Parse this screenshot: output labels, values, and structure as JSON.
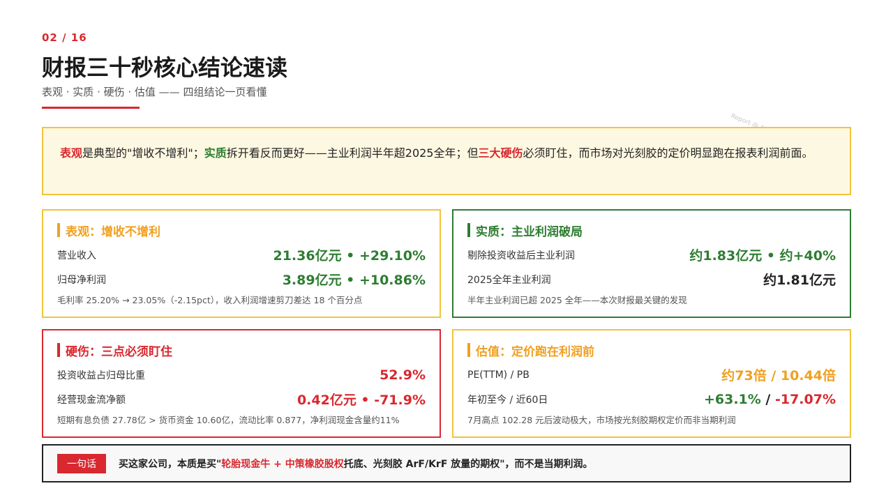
{
  "page_number": "02 / 16",
  "title": "财报三十秒核心结论速读",
  "subtitle": "表观 · 实质 · 硬伤 · 估值 —— 四组结论一页看懂",
  "watermark": "Report @ Alibaba",
  "summary": {
    "k1": "表观",
    "t1": "是典型的\"增收不增利\"；",
    "k2": "实质",
    "t2": "拆开看反而更好——主业利润半年超2025全年；但",
    "k3": "三大硬伤",
    "t3": "必须盯住，而市场对光刻胶的定价明显跑在报表利润前面。"
  },
  "cards": {
    "surface": {
      "title": "表观：增收不增利",
      "rows": [
        {
          "label": "营业收入",
          "value": "21.36亿元 • +29.10%"
        },
        {
          "label": "归母净利润",
          "value": "3.89亿元 • +10.86%"
        }
      ],
      "note": "毛利率 25.20% → 23.05%（-2.15pct），收入利润增速剪刀差达 18 个百分点"
    },
    "substance": {
      "title": "实质：主业利润破局",
      "rows": [
        {
          "label": "剔除投资收益后主业利润",
          "value": "约1.83亿元 • 约+40%"
        },
        {
          "label": "2025全年主业利润",
          "value": "约1.81亿元"
        }
      ],
      "note": "半年主业利润已超 2025 全年——本次财报最关键的发现"
    },
    "flaws": {
      "title": "硬伤：三点必须盯住",
      "rows": [
        {
          "label": "投资收益占归母比重",
          "value": "52.9%"
        },
        {
          "label": "经营现金流净额",
          "value": "0.42亿元 • -71.9%"
        }
      ],
      "note": "短期有息负债 27.78亿 > 货币资金 10.60亿，流动比率 0.877，净利润现金含量约11%"
    },
    "valuation": {
      "title": "估值：定价跑在利润前",
      "rows": [
        {
          "label": "PE(TTM) / PB",
          "value": "约73倍 / 10.44倍"
        },
        {
          "label": "年初至今 / 近60日",
          "value_a": "+63.1%",
          "value_sep": " / ",
          "value_b": "-17.07%"
        }
      ],
      "note": "7月高点 102.28 元后波动极大，市场按光刻胶期权定价而非当期利润"
    }
  },
  "bottom": {
    "tag": "一句话",
    "text_a": "买这家公司，本质是买\"",
    "text_highlight": "轮胎现金牛 + 中策橡胶股权",
    "text_b": "托底、光刻胶 ArF/KrF 放量的期权\"，而不是当期利润。"
  },
  "colors": {
    "red": "#d9282f",
    "green": "#2e7d32",
    "orange": "#f0a020",
    "yellow_border": "#f3c33b",
    "summary_bg": "#fdf8e1"
  }
}
